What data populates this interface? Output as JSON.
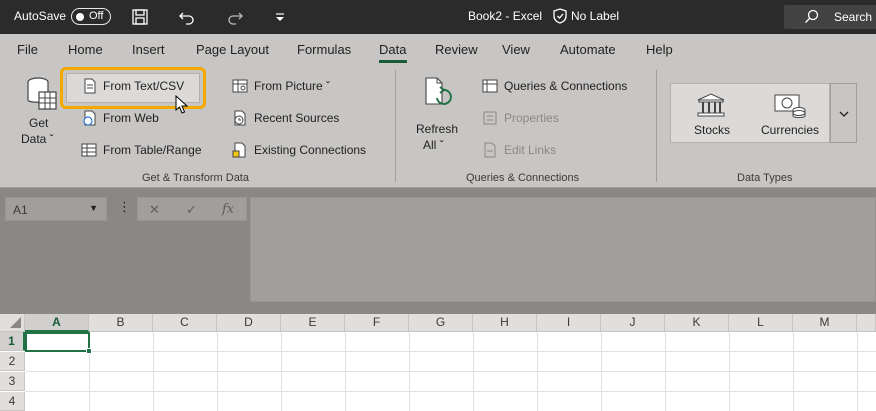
{
  "titlebar": {
    "autosave_label": "AutoSave",
    "autosave_state": "Off",
    "title": "Book2  -  Excel",
    "sensitivity_label": "No Label",
    "search_placeholder": "Search"
  },
  "tabs": [
    {
      "label": "File"
    },
    {
      "label": "Home"
    },
    {
      "label": "Insert"
    },
    {
      "label": "Page Layout"
    },
    {
      "label": "Formulas"
    },
    {
      "label": "Data",
      "active": true
    },
    {
      "label": "Review"
    },
    {
      "label": "View"
    },
    {
      "label": "Automate"
    },
    {
      "label": "Help"
    }
  ],
  "ribbon": {
    "get_data": {
      "line1": "Get",
      "line2": "Data ˇ"
    },
    "from_text_csv": "From Text/CSV",
    "from_web": "From Web",
    "from_table_range": "From Table/Range",
    "from_picture": "From Picture ˇ",
    "recent_sources": "Recent Sources",
    "existing_connections": "Existing Connections",
    "group_get_transform": "Get & Transform Data",
    "refresh_all": {
      "line1": "Refresh",
      "line2": "All ˇ"
    },
    "queries_connections": "Queries & Connections",
    "properties": "Properties",
    "edit_links": "Edit Links",
    "group_queries": "Queries & Connections",
    "stocks": "Stocks",
    "currencies": "Currencies",
    "group_data_types": "Data Types"
  },
  "formula_bar": {
    "name_box": "A1",
    "fx": "fx"
  },
  "grid": {
    "columns": [
      "A",
      "B",
      "C",
      "D",
      "E",
      "F",
      "G",
      "H",
      "I",
      "J",
      "K",
      "L",
      "M"
    ],
    "rows": [
      "1",
      "2",
      "3",
      "4"
    ],
    "active_cell": "A1"
  },
  "colors": {
    "titlebar_bg": "#2b2b2b",
    "ribbon_bg": "#c8c6c4",
    "highlight": "#f2a900",
    "excel_green": "#217346"
  }
}
